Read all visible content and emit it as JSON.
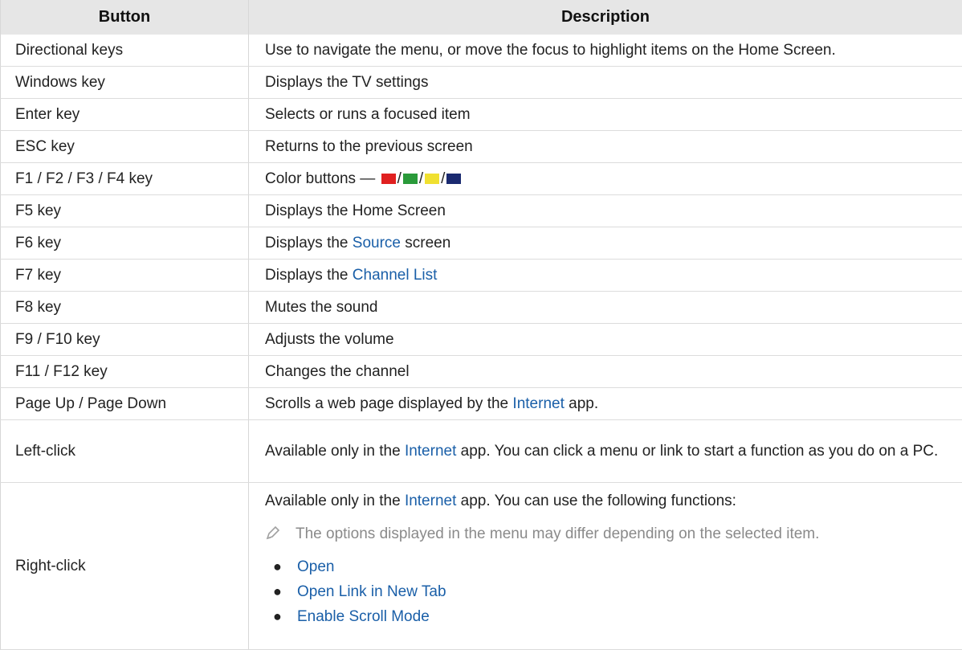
{
  "table": {
    "headers": {
      "button": "Button",
      "description": "Description"
    },
    "rows": [
      {
        "button": "Directional keys",
        "desc": "Use to navigate the menu, or move the focus to highlight items on the Home Screen."
      },
      {
        "button": "Windows key",
        "desc": "Displays the TV settings"
      },
      {
        "button": "Enter key",
        "desc": "Selects or runs a focused item"
      },
      {
        "button": "ESC key",
        "desc": "Returns to the previous screen"
      },
      {
        "button": "F1 / F2 / F3 / F4 key",
        "desc_prefix": "Color buttons —",
        "slash": "/",
        "colors": [
          "#e02020",
          "#2a9a3a",
          "#f0e030",
          "#1a2a70"
        ]
      },
      {
        "button": "F5 key",
        "desc": "Displays the Home Screen"
      },
      {
        "button": "F6 key",
        "desc_pre": "Displays the ",
        "desc_link": "Source",
        "desc_post": " screen"
      },
      {
        "button": "F7 key",
        "desc_pre": "Displays the ",
        "desc_link": "Channel List"
      },
      {
        "button": "F8 key",
        "desc": "Mutes the sound"
      },
      {
        "button": "F9 / F10 key",
        "desc": "Adjusts the volume"
      },
      {
        "button": "F11 / F12 key",
        "desc": "Changes the channel"
      },
      {
        "button": "Page Up / Page Down",
        "desc_pre": "Scrolls a web page displayed by the ",
        "desc_link": "Internet",
        "desc_post": " app."
      },
      {
        "button": "Left-click",
        "desc_pre": "Available only in the ",
        "desc_link": "Internet",
        "desc_post": " app. You can click a menu or link to start a function as you do on a PC."
      },
      {
        "button": "Right-click",
        "desc_pre": "Available only in the ",
        "desc_link": "Internet",
        "desc_post": " app. You can use the following functions:",
        "note": "The options displayed in the menu may differ depending on the selected item.",
        "items": [
          "Open",
          "Open Link in New Tab",
          "Enable Scroll Mode"
        ]
      }
    ]
  }
}
